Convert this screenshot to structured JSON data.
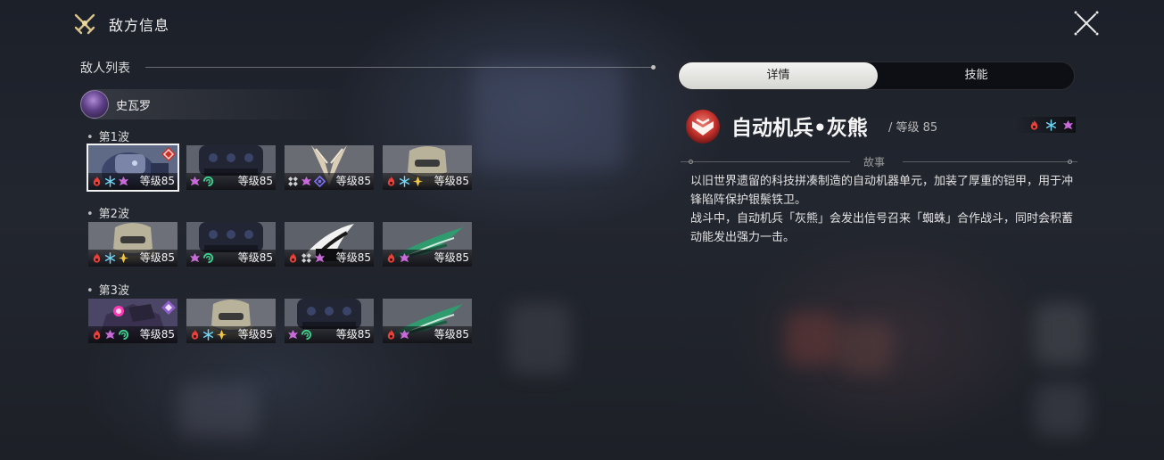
{
  "header": {
    "title": "敌方信息",
    "icon": "crossed-swords-icon",
    "close_icon": "close-icon"
  },
  "enemy_list": {
    "label": "敌人列表",
    "boss": {
      "name": "史瓦罗",
      "avatar": "boss-avatar"
    },
    "waves": [
      {
        "title": "第1波",
        "enemies": [
          {
            "level": "等级85",
            "portrait": "mech-grey",
            "elements": [
              "fire",
              "ice",
              "imaginary"
            ],
            "corner": "fire-weak-badge",
            "selected": true
          },
          {
            "level": "等级85",
            "portrait": "mech-dark",
            "elements": [
              "imaginary",
              "wind"
            ],
            "corner": null,
            "selected": false
          },
          {
            "level": "等级85",
            "portrait": "horned-white",
            "elements": [
              "physical",
              "imaginary",
              "quantum"
            ],
            "corner": null,
            "selected": false
          },
          {
            "level": "等级85",
            "portrait": "helmet-gold",
            "elements": [
              "fire",
              "ice",
              "lightning"
            ],
            "corner": null,
            "selected": false
          }
        ]
      },
      {
        "title": "第2波",
        "enemies": [
          {
            "level": "等级85",
            "portrait": "helmet-gold",
            "elements": [
              "fire",
              "ice",
              "lightning"
            ],
            "corner": null,
            "selected": false
          },
          {
            "level": "等级85",
            "portrait": "mech-dark",
            "elements": [
              "imaginary",
              "wind"
            ],
            "corner": null,
            "selected": false
          },
          {
            "level": "等级85",
            "portrait": "white-feather",
            "elements": [
              "fire",
              "physical",
              "imaginary"
            ],
            "corner": null,
            "selected": false
          },
          {
            "level": "等级85",
            "portrait": "green-wing",
            "elements": [
              "fire",
              "imaginary"
            ],
            "corner": null,
            "selected": false
          }
        ]
      },
      {
        "title": "第3波",
        "enemies": [
          {
            "level": "等级85",
            "portrait": "boss-purple",
            "elements": [
              "fire",
              "imaginary",
              "wind"
            ],
            "corner": "imaginary-badge",
            "selected": false
          },
          {
            "level": "等级85",
            "portrait": "helmet-gold",
            "elements": [
              "fire",
              "ice",
              "lightning"
            ],
            "corner": null,
            "selected": false
          },
          {
            "level": "等级85",
            "portrait": "mech-dark",
            "elements": [
              "imaginary",
              "wind"
            ],
            "corner": null,
            "selected": false
          },
          {
            "level": "等级85",
            "portrait": "green-wing",
            "elements": [
              "fire",
              "imaginary"
            ],
            "corner": null,
            "selected": false
          }
        ]
      }
    ]
  },
  "tabs": [
    {
      "label": "详情",
      "active": true
    },
    {
      "label": "技能",
      "active": false
    }
  ],
  "detail": {
    "name": "自动机兵•灰熊",
    "level": "/ 等级 85",
    "weaknesses": [
      "fire",
      "ice",
      "imaginary"
    ],
    "story_label": "故事",
    "story": [
      "以旧世界遗留的科技拼凑制造的自动机器单元，加装了厚重的铠甲，用于冲锋陷阵保护银鬃铁卫。",
      "战斗中，自动机兵「灰熊」会发出信号召来「蜘蛛」合作战斗，同时会积蓄动能发出强力一击。"
    ]
  },
  "colors": {
    "fire": "#e8423a",
    "ice": "#6fd3f2",
    "imaginary": "#c86bd8",
    "wind": "#3fcf8c",
    "lightning": "#f2c643",
    "quantum": "#7a6cf0",
    "physical": "#d0d0d0"
  }
}
